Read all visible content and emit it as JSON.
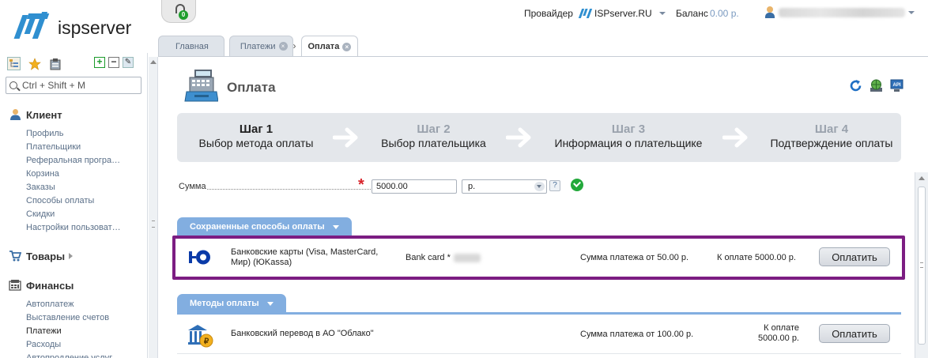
{
  "app": {
    "logo_text": "ispserver"
  },
  "topbar": {
    "support_badge": "0",
    "provider_label": "Провайдер",
    "provider_value": "ISPserver.RU",
    "balance_label": "Баланс",
    "balance_value": "0.00 р."
  },
  "tabs": [
    {
      "label": "Главная"
    },
    {
      "label": "Платежи"
    },
    {
      "label": "Оплата"
    }
  ],
  "sidebar": {
    "search_placeholder": "Ctrl + Shift + M",
    "groups": [
      {
        "label": "Клиент",
        "items": [
          "Профиль",
          "Плательщики",
          "Реферальная програ…",
          "Корзина",
          "Заказы",
          "Способы оплаты",
          "Скидки",
          "Настройки пользоват…"
        ]
      },
      {
        "label": "Товары",
        "items": []
      },
      {
        "label": "Финансы",
        "items": [
          "Автоплатеж",
          "Выставление счетов",
          "Платежи",
          "Расходы",
          "Автопродление услуг"
        ]
      }
    ]
  },
  "page": {
    "title": "Оплата",
    "head_icons": [
      "refresh-icon",
      "web-icon",
      "api-icon"
    ]
  },
  "wizard": {
    "steps": [
      {
        "num": "Шаг 1",
        "title": "Выбор метода оплаты"
      },
      {
        "num": "Шаг 2",
        "title": "Выбор плательщика"
      },
      {
        "num": "Шаг 3",
        "title": "Информация о плательщике"
      },
      {
        "num": "Шаг 4",
        "title": "Подтверждение оплаты"
      }
    ]
  },
  "form": {
    "sum_label": "Сумма",
    "sum_value": "5000.00",
    "currency": "р.",
    "help": "?"
  },
  "saved": {
    "section_label": "Сохраненные способы оплаты",
    "row": {
      "name_line1": "Банковские карты (Visa, MasterCard,",
      "name_line2": "Мир) (ЮKassa)",
      "card": "Bank card *",
      "min_sum": "Сумма платежа от 50.00 р.",
      "to_pay": "К оплате 5000.00 р.",
      "button": "Оплатить"
    }
  },
  "methods": {
    "section_label": "Методы оплаты",
    "row": {
      "name": "Банковский перевод в АО \"Облако\"",
      "min_sum": "Сумма платежа от 100.00 р.",
      "to_pay_line1": "К оплате",
      "to_pay_line2": "5000.00 р.",
      "button": "Оплатить"
    }
  },
  "colors": {
    "accent": "#82aee0",
    "highlight": "#7c1d82",
    "brand": "#2f8fd0",
    "ok": "#23a93b",
    "required": "#d8232a"
  }
}
